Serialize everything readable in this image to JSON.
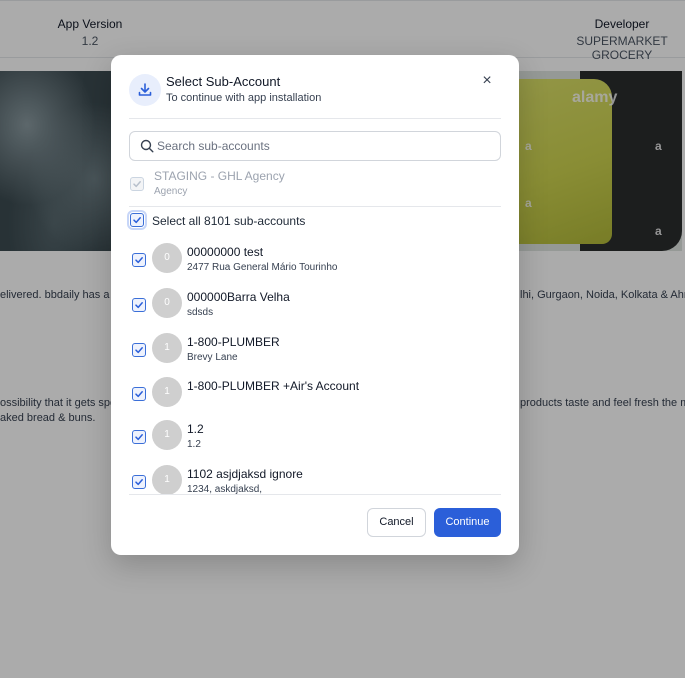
{
  "background": {
    "app_version": {
      "label": "App Version",
      "value": "1.2"
    },
    "developer": {
      "label": "Developer",
      "value": "SUPERMARKET GROCERY"
    },
    "watermark": "alamy",
    "desc_line1_left": "elivered. bbdaily has a pr",
    "desc_line1_right": "lhi, Gurgaon, Noida, Kolkata & Ahme",
    "desc_line2_left": "ossibility that it gets spo",
    "desc_line2_right": "products taste and feel fresh the mo",
    "desc_line3_left": "aked bread & buns."
  },
  "modal": {
    "title": "Select Sub-Account",
    "subtitle": "To continue with app installation",
    "close_glyph": "×",
    "search": {
      "placeholder": "Search sub-accounts",
      "value": ""
    },
    "agency": {
      "name": "STAGING - GHL Agency",
      "type": "Agency",
      "checked": true,
      "disabled": true
    },
    "select_all": {
      "label": "Select all 8101 sub-accounts",
      "checked": true
    },
    "accounts": [
      {
        "initial": "0",
        "name": "00000000 test",
        "address": "2477 Rua General Mário Tourinho",
        "checked": true
      },
      {
        "initial": "0",
        "name": "000000Barra Velha",
        "address": "sdsds",
        "checked": true
      },
      {
        "initial": "1",
        "name": "1-800-PLUMBER",
        "address": "Brevy Lane",
        "checked": true
      },
      {
        "initial": "1",
        "name": "1-800-PLUMBER +Air's Account",
        "address": "",
        "checked": true
      },
      {
        "initial": "1",
        "name": "1.2",
        "address": "1.2",
        "checked": true
      },
      {
        "initial": "1",
        "name": "1102 asjdjaksd ignore",
        "address": "1234, askdjaksd,",
        "checked": true
      }
    ],
    "cancel_label": "Cancel",
    "continue_label": "Continue",
    "colors": {
      "primary": "#2b5fd9",
      "avatar": "#cfcfcf",
      "icon_bg": "#e8eefc"
    }
  }
}
